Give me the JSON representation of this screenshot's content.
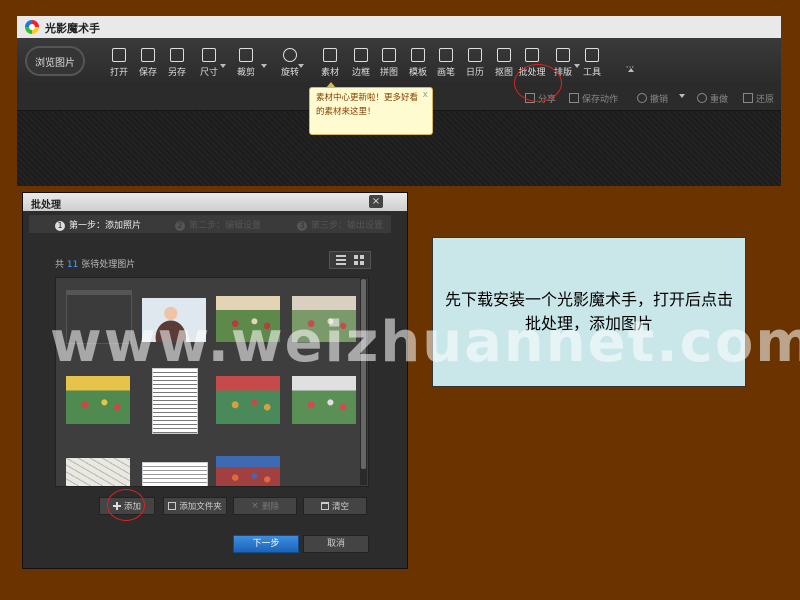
{
  "app": {
    "title": "光影魔术手",
    "browse_label": "浏览图片",
    "tools": [
      {
        "label": "打开",
        "icon": "open-icon"
      },
      {
        "label": "保存",
        "icon": "save-icon"
      },
      {
        "label": "另存",
        "icon": "save-as-icon"
      },
      {
        "label": "尺寸",
        "icon": "resize-icon"
      },
      {
        "label": "裁剪",
        "icon": "crop-icon"
      },
      {
        "label": "旋转",
        "icon": "rotate-icon"
      },
      {
        "label": "素材",
        "icon": "material-icon"
      },
      {
        "label": "边框",
        "icon": "border-icon"
      },
      {
        "label": "拼图",
        "icon": "collage-icon"
      },
      {
        "label": "模板",
        "icon": "template-icon"
      },
      {
        "label": "画笔",
        "icon": "brush-icon"
      },
      {
        "label": "日历",
        "icon": "calendar-icon"
      },
      {
        "label": "抠图",
        "icon": "cutout-icon"
      },
      {
        "label": "批处理",
        "icon": "batch-icon"
      },
      {
        "label": "排版",
        "icon": "layout-icon"
      },
      {
        "label": "工具",
        "icon": "wrench-icon"
      },
      {
        "label": "···",
        "icon": "more-icon"
      }
    ],
    "subbar": {
      "share": "分享",
      "save_action": "保存动作",
      "undo": "撤销",
      "redo": "重做",
      "restore": "还原"
    },
    "tooltip": {
      "text": "素材中心更新啦！更多好看的素材来这里！",
      "close": "x"
    }
  },
  "dialog": {
    "title": "批处理",
    "close": "×",
    "steps": [
      {
        "num": "1",
        "label": "第一步：添加照片",
        "active": true
      },
      {
        "num": "2",
        "label": "第二步：编辑设置",
        "active": false
      },
      {
        "num": "3",
        "label": "第三步：输出设置",
        "active": false
      }
    ],
    "count_prefix": "共",
    "count": "11",
    "count_suffix": "张待处理图片",
    "buttons": {
      "add": "添加",
      "add_folder": "添加文件夹",
      "delete": "删除",
      "clear": "清空",
      "next": "下一步",
      "cancel": "取消"
    },
    "thumbnails": [
      {
        "kind": "screenshot",
        "colors": [
          "#3b3b3b",
          "#2a2a2a",
          "#555555"
        ]
      },
      {
        "kind": "portrait",
        "colors": [
          "#dfe8ee",
          "#5b3b35",
          "#efc3a6"
        ]
      },
      {
        "kind": "photo",
        "colors": [
          "#5d8a4a",
          "#b43d3d",
          "#e2d4b4"
        ]
      },
      {
        "kind": "photo",
        "colors": [
          "#7a9a6a",
          "#c05050",
          "#d9d0c0"
        ]
      },
      {
        "kind": "photo",
        "colors": [
          "#4f8a50",
          "#d04545",
          "#e6c34a"
        ]
      },
      {
        "kind": "document",
        "colors": [
          "#ffffff",
          "#777777",
          "#c44444"
        ]
      },
      {
        "kind": "photo",
        "colors": [
          "#4a8a5a",
          "#d3a23e",
          "#c64a4a"
        ]
      },
      {
        "kind": "photo",
        "colors": [
          "#5a8f55",
          "#d44a4a",
          "#e0e0e0"
        ]
      },
      {
        "kind": "map",
        "colors": [
          "#e9e8e2",
          "#b9b8a8",
          "#d9c38a"
        ]
      },
      {
        "kind": "document",
        "colors": [
          "#ffffff",
          "#999999",
          "#cc3333"
        ]
      },
      {
        "kind": "photo",
        "colors": [
          "#a04040",
          "#e26a3a",
          "#3d6ab0"
        ]
      }
    ]
  },
  "note": {
    "text": "先下载安装一个光影魔术手，打开后点击批处理，添加图片"
  },
  "watermark": "www.weizhuannet.com",
  "colors": {
    "background": "#6b3300",
    "accent_blue": "#1b64b8",
    "highlight_red": "#d22222",
    "note_bg": "#c9e6e8"
  }
}
